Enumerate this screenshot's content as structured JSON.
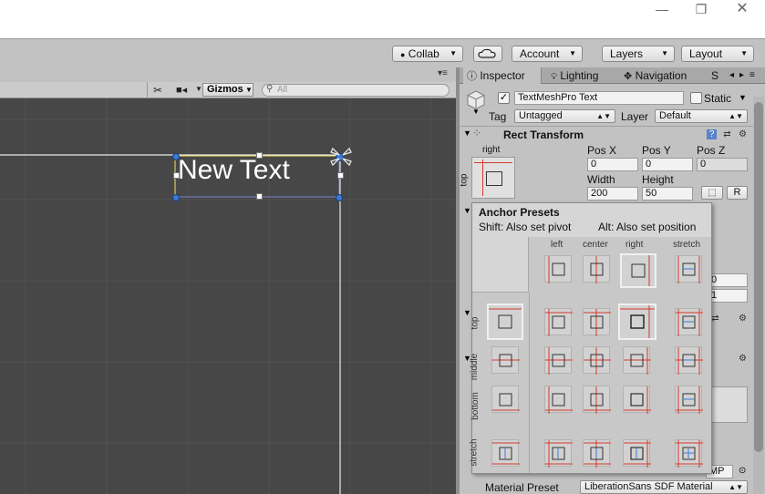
{
  "titlebar": {
    "minimize_icon": "minimize-icon",
    "maximize_icon": "maximize-icon",
    "close_icon": "close-icon"
  },
  "toolbar": {
    "collab": "Collab",
    "cloud_icon": "cloud-icon",
    "account": "Account",
    "layers": "Layers",
    "layout": "Layout"
  },
  "scene": {
    "gizmos": "Gizmos",
    "search_placeholder": "All",
    "text": "New Text"
  },
  "inspector": {
    "tabs": [
      {
        "label": "Inspector",
        "icon": "info-icon"
      },
      {
        "label": "Lighting",
        "icon": "lightbulb-icon"
      },
      {
        "label": "Navigation",
        "icon": "navigation-icon"
      },
      {
        "label": "S",
        "icon": ""
      }
    ],
    "object_name": "TextMeshPro Text",
    "active_check": "✓",
    "static_label": "Static",
    "tag_label": "Tag",
    "tag_value": "Untagged",
    "layer_label": "Layer",
    "layer_value": "Default",
    "rect_title": "Rect Transform",
    "anchor_h": "right",
    "anchor_v": "top",
    "pos_x_label": "Pos X",
    "pos_y_label": "Pos Y",
    "pos_z_label": "Pos Z",
    "pos_x": "0",
    "pos_y": "0",
    "pos_z": "0",
    "width_label": "Width",
    "height_label": "Height",
    "width": "200",
    "height": "50",
    "r_button": "R",
    "hidden_field_1": "0",
    "hidden_field_2": "1",
    "mp_fragment": "MP",
    "material_label": "Material Preset",
    "material_value": "LiberationSans SDF Material"
  },
  "presets": {
    "title": "Anchor Presets",
    "shift_hint": "Shift: Also set pivot",
    "alt_hint": "Alt: Also set position",
    "col_labels": [
      "left",
      "center",
      "right",
      "stretch"
    ],
    "row_labels": [
      "top",
      "middle",
      "bottom",
      "stretch"
    ]
  },
  "colors": {
    "accent_red": "#d43a2a",
    "accent_blue": "#3a7ad8",
    "anchor_orange": "#e08a2a",
    "selection_yellow": "#f3e36a"
  }
}
